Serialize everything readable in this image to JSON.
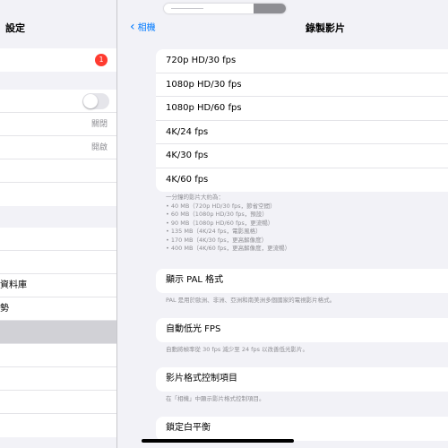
{
  "left": {
    "title": "設定",
    "badge_count": "1",
    "rows_b": [
      {
        "label": "",
        "value": ""
      },
      {
        "label": "",
        "value": "關閉"
      },
      {
        "label": "",
        "value": "開啟"
      },
      {
        "label": "",
        "value": ""
      },
      {
        "label": "",
        "value": ""
      }
    ],
    "rows_c": [
      {
        "label": ""
      },
      {
        "label": ""
      },
      {
        "label": "資料庫"
      },
      {
        "label": "勢"
      },
      {
        "label": ""
      },
      {
        "label": ""
      },
      {
        "label": ""
      },
      {
        "label": ""
      }
    ]
  },
  "nav": {
    "back_label": "相機",
    "title": "錄製影片"
  },
  "video_formats": [
    "720p HD/30 fps",
    "1080p HD/30 fps",
    "1080p HD/60 fps",
    "4K/24 fps",
    "4K/30 fps",
    "4K/60 fps"
  ],
  "size_notes": [
    "一分鐘的影片大約為：",
    "• 40 MB（720p HD/30 fps，節省空間）",
    "• 60 MB（1080p HD/30 fps，預設）",
    "• 90 MB（1080p HD/60 fps，更流暢）",
    "• 135 MB（4K/24 fps，電影風格）",
    "• 170 MB（4K/30 fps，更高解像度）",
    "• 400 MB（4K/60 fps，更高解像度，更流暢）"
  ],
  "pal": {
    "label": "顯示 PAL 格式",
    "note": "PAL 是用於歐洲、非洲、亞洲和南美洲多個國家的電視影片格式。"
  },
  "low_light": {
    "label": "自動低光 FPS",
    "note": "自動將幀率從 30 fps 減少至 24 fps 以改善低光影片。"
  },
  "format_control": {
    "label": "影片格式控制項目",
    "note": "在「相機」中顯示影片格式控制項目。"
  },
  "white_balance": {
    "label": "鎖定白平衡"
  }
}
